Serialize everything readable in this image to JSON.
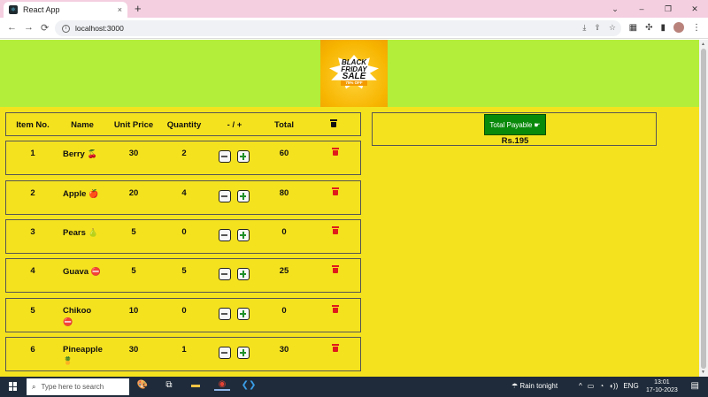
{
  "browser": {
    "tab_title": "React App",
    "tab_close": "×",
    "new_tab": "+",
    "window_controls": [
      "⌄",
      "–",
      "❐",
      "✕"
    ],
    "url": "localhost:3000",
    "nav": {
      "back": "←",
      "forward": "→",
      "reload": "⟳"
    },
    "omnibox_icons": [
      "download-icon",
      "share-icon",
      "star-icon"
    ],
    "toolbar_icons": [
      "ext-icon",
      "puzzle-icon",
      "sidepanel-icon",
      "profile-icon",
      "menu-icon"
    ]
  },
  "banner": {
    "line1": "BLACK",
    "line2": "FRIDAY",
    "line3": "SALE",
    "badge": "75% OFF"
  },
  "table": {
    "headers": {
      "item_no": "Item No.",
      "name": "Name",
      "unit_price": "Unit Price",
      "quantity": "Quantity",
      "step": "- / +",
      "total": "Total"
    },
    "rows": [
      {
        "no": "1",
        "name": "Berry",
        "emoji": "🍒",
        "price": "30",
        "qty": "2",
        "total": "60"
      },
      {
        "no": "2",
        "name": "Apple",
        "emoji": "🍎",
        "price": "20",
        "qty": "4",
        "total": "80"
      },
      {
        "no": "3",
        "name": "Pears",
        "emoji": "🍐",
        "price": "5",
        "qty": "0",
        "total": "0"
      },
      {
        "no": "4",
        "name": "Guava",
        "emoji": "⛔",
        "price": "5",
        "qty": "5",
        "total": "25"
      },
      {
        "no": "5",
        "name": "Chikoo",
        "emoji": "⛔",
        "price": "10",
        "qty": "0",
        "total": "0"
      },
      {
        "no": "6",
        "name": "Pineapple",
        "emoji": "🍍",
        "price": "30",
        "qty": "1",
        "total": "30"
      }
    ]
  },
  "summary": {
    "button_label": "Total Payable",
    "button_icon": "☛",
    "amount": "Rs.195"
  },
  "taskbar": {
    "search_placeholder": "Type here to search",
    "weather": "Rain tonight",
    "lang": "ENG",
    "time": "13:01",
    "date": "17-10-2023"
  },
  "colors": {
    "page_bg": "#f5e21f",
    "banner_bg": "#b3ee3a",
    "total_button": "#0a8a0a",
    "delete_icon": "#e01b1b"
  }
}
